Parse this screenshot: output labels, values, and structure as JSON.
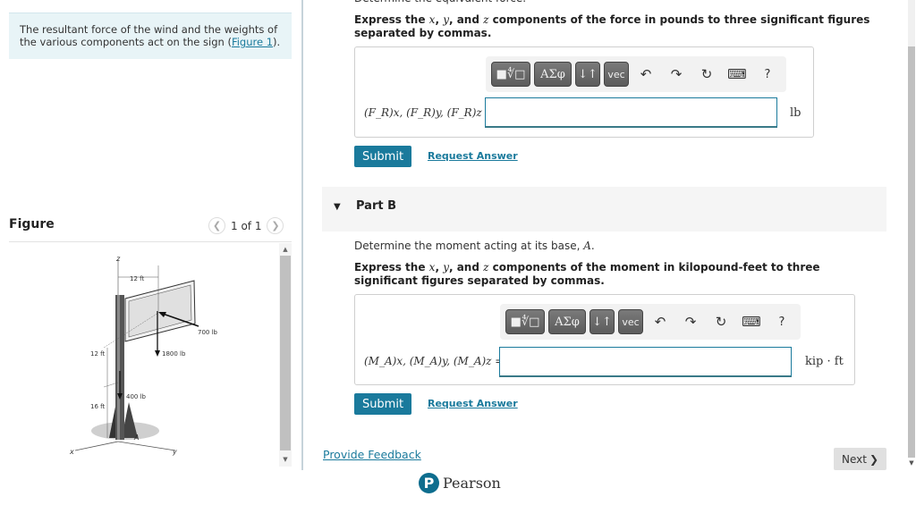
{
  "intro": {
    "text": "The resultant force of the wind and the weights of the various components act on the sign (",
    "link": "Figure 1",
    "after": ")."
  },
  "figure": {
    "title": "Figure",
    "pager": "1 of 1",
    "labels": {
      "z": "z",
      "x": "x",
      "y": "y",
      "A": "A",
      "width": "12 ft",
      "height_upper": "12 ft",
      "height_lower": "16 ft",
      "f_wind": "700 lb",
      "f_sign": "1800 lb",
      "f_pole": "400 lb"
    }
  },
  "partA": {
    "top_cut": "Determine the equivalent force.",
    "instr_1": "Express the ",
    "vx": "x",
    "sep1": ", ",
    "vy": "y",
    "sep2": ", and ",
    "vz": "z",
    "instr_2": " components of the force in pounds to three significant figures separated by commas.",
    "eq_label": "(F_R)x, (F_R)y, (F_R)z =",
    "input_value": "",
    "unit": "lb",
    "submit": "Submit",
    "request": "Request Answer"
  },
  "partB": {
    "title": "Part B",
    "prompt_1": "Determine the moment acting at its base, ",
    "prompt_var": "A",
    "prompt_2": ".",
    "instr_1": "Express the ",
    "vx": "x",
    "sep1": ", ",
    "vy": "y",
    "sep2": ", and ",
    "vz": "z",
    "instr_2": " components of the moment in kilopound-feet to three significant figures separated by commas.",
    "eq_label": "(M_A)x, (M_A)y, (M_A)z =",
    "input_value": "",
    "unit": "kip · ft",
    "submit": "Submit",
    "request": "Request Answer"
  },
  "toolbar": {
    "templates": "■∜□",
    "greek": "ΑΣφ",
    "arrows": "↓↑",
    "vec": "vec",
    "undo": "↶",
    "redo": "↷",
    "reset": "↻",
    "keyboard": "⌨",
    "help": "?"
  },
  "footer": {
    "feedback": "Provide Feedback",
    "next": "Next",
    "next_icon": "❯",
    "brand": "Pearson",
    "brand_letter": "P"
  }
}
